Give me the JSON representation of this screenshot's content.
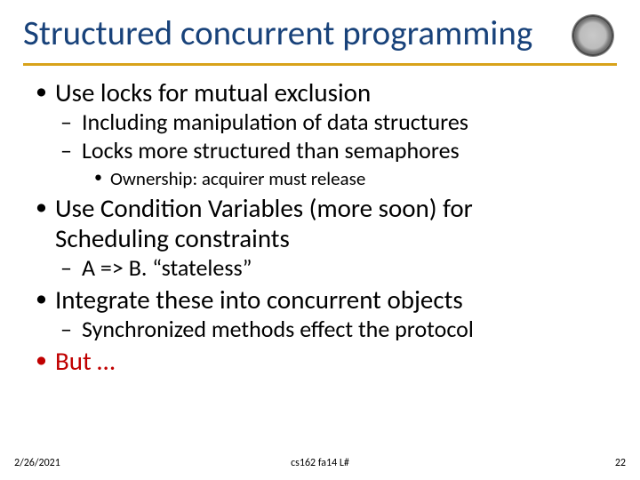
{
  "title": "Structured concurrent programming",
  "bullets": {
    "b1_locks": "Use locks for mutual exclusion",
    "b2_incl": "Including manipulation of data structures",
    "b2_locksmore": "Locks more structured than semaphores",
    "b3_owner": "Ownership: acquirer must release",
    "b1_cv_a": "Use Condition Variables (more soon) for",
    "b1_cv_b": "Scheduling constraints",
    "b2_ab": "A => B. “stateless”",
    "b1_integrate": "Integrate these into concurrent objects",
    "b2_sync": "Synchronized methods effect the protocol",
    "b1_but": "But …"
  },
  "footer": {
    "date": "2/26/2021",
    "course": "cs162 fa14 L#",
    "page": "22"
  }
}
